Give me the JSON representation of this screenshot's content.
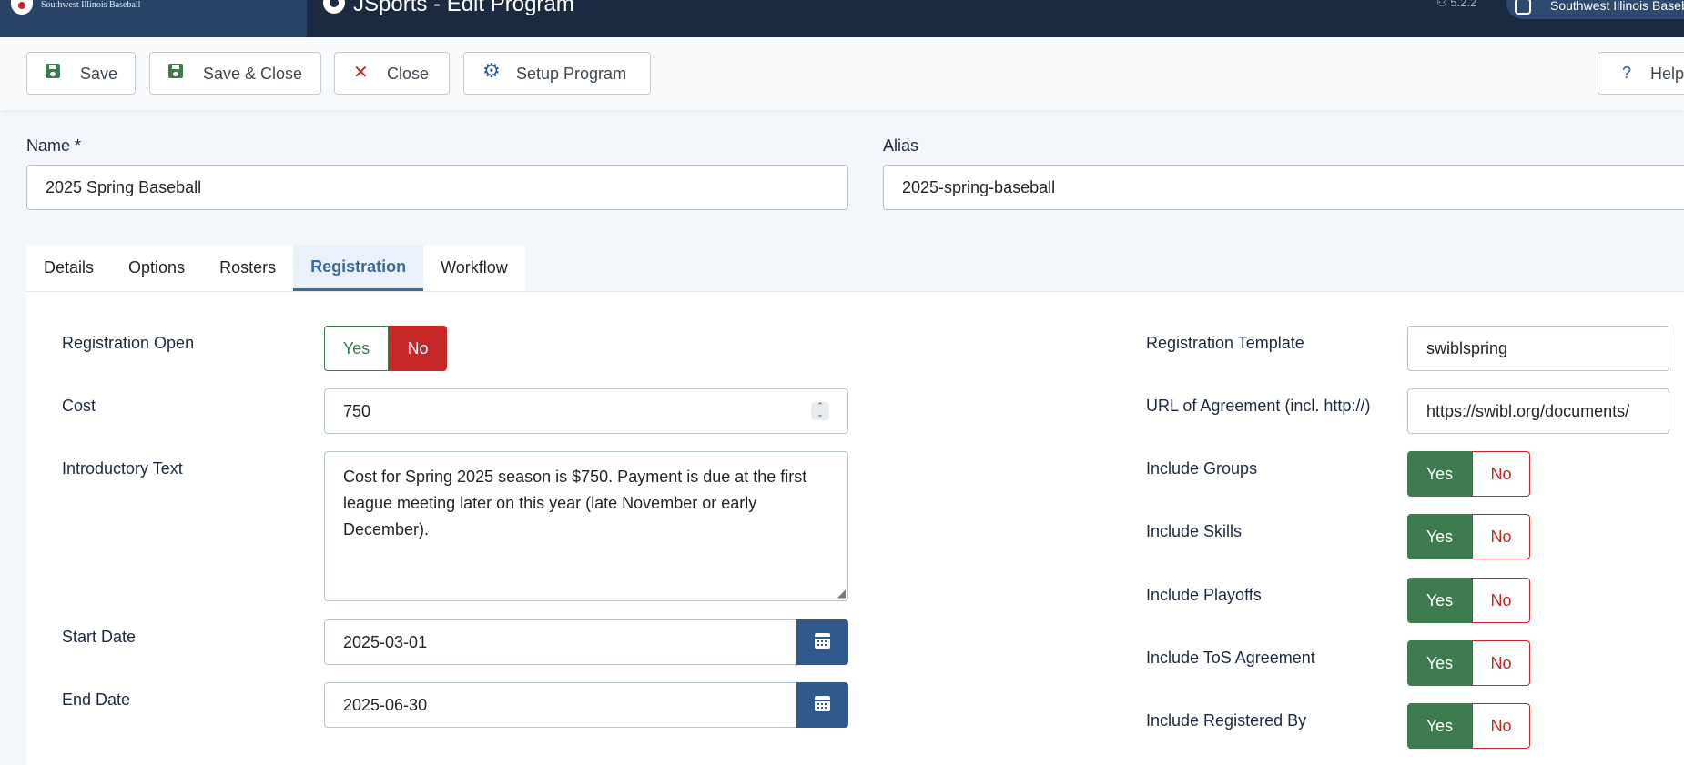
{
  "header": {
    "brand_text": "Southwest Illinois Baseball",
    "app_title": "JSports - Edit Program",
    "version": "5.2.2",
    "site_link": "Southwest Illinois Baseball"
  },
  "toolbar": {
    "save": "Save",
    "save_close": "Save & Close",
    "close": "Close",
    "setup": "Setup Program",
    "help": "Help"
  },
  "form": {
    "name_label": "Name *",
    "name_value": "2025 Spring Baseball",
    "alias_label": "Alias",
    "alias_value": "2025-spring-baseball"
  },
  "tabs": [
    "Details",
    "Options",
    "Rosters",
    "Registration",
    "Workflow"
  ],
  "active_tab": "Registration",
  "registration": {
    "reg_open_label": "Registration Open",
    "reg_open_value": "No",
    "cost_label": "Cost",
    "cost_value": "750",
    "intro_label": "Introductory Text",
    "intro_value": "Cost for Spring 2025 season is $750.   Payment is due at the first league meeting later on this year (late November or early December).",
    "start_label": "Start Date",
    "start_value": "2025-03-01",
    "end_label": "End Date",
    "end_value": "2025-06-30",
    "template_label": "Registration Template",
    "template_value": "swiblspring",
    "url_label": "URL of Agreement (incl. http://)",
    "url_value": "https://swibl.org/documents/",
    "groups_label": "Include Groups",
    "skills_label": "Include Skills",
    "playoffs_label": "Include Playoffs",
    "tos_label": "Include ToS Agreement",
    "regby_label": "Include Registered By",
    "yes": "Yes",
    "no": "No"
  },
  "colors": {
    "header_bg": "#1c2a41",
    "brand_bg": "#2a4468",
    "yes_green": "#3e7b4f",
    "no_red": "#c52827",
    "accent_blue": "#2f5a8b"
  }
}
